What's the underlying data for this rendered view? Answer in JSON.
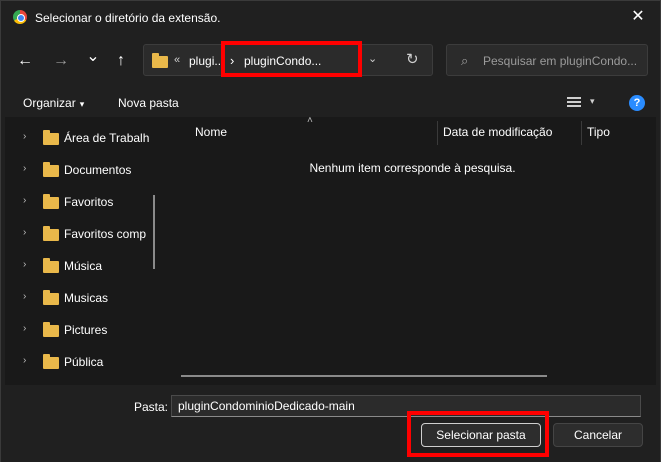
{
  "window": {
    "title": "Selecionar o diretório da extensão.",
    "close_glyph": "✕"
  },
  "nav": {
    "back_glyph": "←",
    "forward_glyph": "→",
    "recent_glyph": "⌄",
    "up_glyph": "↑"
  },
  "address": {
    "overflow": "«",
    "crumbs": [
      "plugi...",
      "pluginCondo..."
    ],
    "separator": "›",
    "dropdown_glyph": "⌄",
    "refresh_glyph": "↻"
  },
  "search": {
    "placeholder": "Pesquisar em pluginCondo...",
    "glyph": "⌕"
  },
  "toolbar": {
    "organize_label": "Organizar",
    "organize_caret": "▾",
    "new_folder_label": "Nova pasta",
    "view_caret": "▾",
    "help_glyph": "?"
  },
  "sidebar": {
    "chevron": "›",
    "items": [
      {
        "label": "Área de Trabalh"
      },
      {
        "label": "Documentos"
      },
      {
        "label": "Favoritos"
      },
      {
        "label": "Favoritos comp"
      },
      {
        "label": "Música"
      },
      {
        "label": "Musicas"
      },
      {
        "label": "Pictures"
      },
      {
        "label": "Pública"
      }
    ]
  },
  "filelist": {
    "sort_glyph": "˄",
    "columns": [
      "Nome",
      "Data de modificação",
      "Tipo"
    ],
    "empty_message": "Nenhum item corresponde à pesquisa."
  },
  "footer": {
    "folder_label": "Pasta:",
    "folder_value": "pluginCondominioDedicado-main",
    "select_button": "Selecionar pasta",
    "cancel_button": "Cancelar"
  },
  "colors": {
    "background": "#202020",
    "highlight": "#ff0000",
    "folder": "#e9b84a",
    "help": "#2a8cff"
  },
  "icons": [
    "app-icon",
    "close-icon",
    "back-icon",
    "forward-icon",
    "recent-dropdown-icon",
    "up-icon",
    "folder-icon",
    "refresh-icon",
    "search-icon",
    "view-icon",
    "help-icon",
    "chevron-right-icon"
  ]
}
